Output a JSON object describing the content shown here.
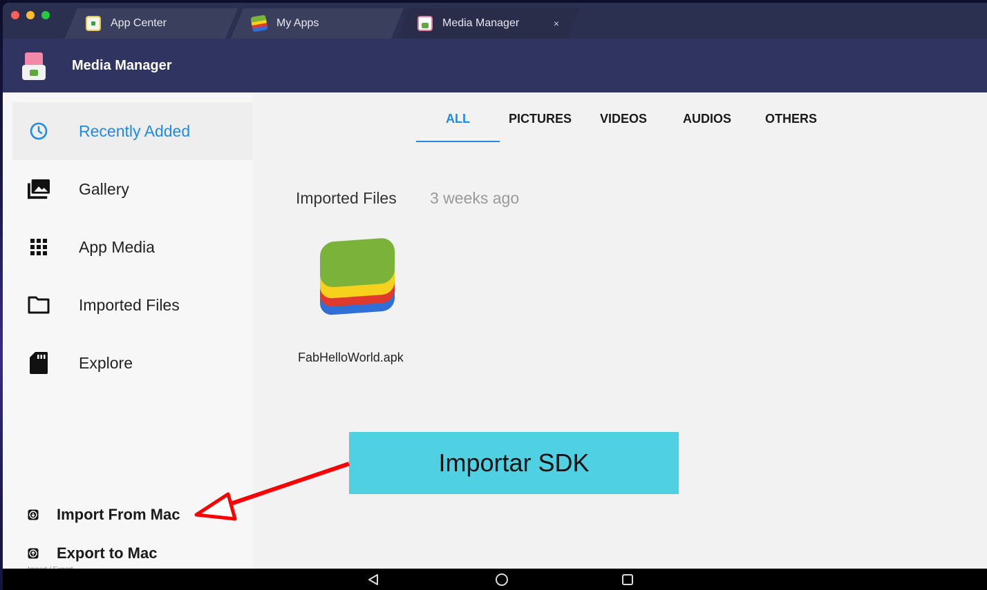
{
  "tabs": [
    {
      "label": "App Center",
      "icon": "app-center-icon"
    },
    {
      "label": "My Apps",
      "icon": "my-apps-icon"
    },
    {
      "label": "Media Manager",
      "icon": "media-manager-icon",
      "active": true,
      "close": "×"
    }
  ],
  "header": {
    "title": "Media Manager"
  },
  "sidebar": {
    "items": [
      {
        "label": "Recently Added",
        "icon": "clock-icon",
        "active": true
      },
      {
        "label": "Gallery",
        "icon": "gallery-icon"
      },
      {
        "label": "App Media",
        "icon": "grid-icon"
      },
      {
        "label": "Imported Files",
        "icon": "folder-icon"
      },
      {
        "label": "Explore",
        "icon": "sd-card-icon"
      }
    ],
    "import_export": {
      "heading": "Import / Export",
      "import_label": "Import From Mac",
      "export_label": "Export to Mac"
    }
  },
  "filters": [
    "ALL",
    "PICTURES",
    "VIDEOS",
    "AUDIOS",
    "OTHERS"
  ],
  "active_filter": "ALL",
  "section": {
    "title": "Imported Files",
    "time": "3 weeks ago"
  },
  "files": [
    {
      "name": "FabHelloWorld.apk",
      "icon": "bluestacks-icon"
    }
  ],
  "annotation": {
    "text": "Importar SDK"
  },
  "colors": {
    "accent": "#1e8be6",
    "header_bg": "#2f3560",
    "annotation_bg": "#4fd0e3",
    "arrow": "#ff0000"
  }
}
